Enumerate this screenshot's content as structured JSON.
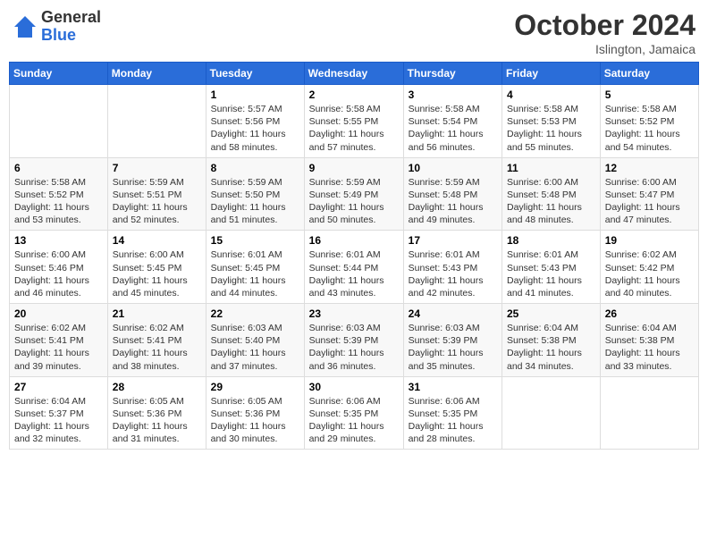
{
  "logo": {
    "general": "General",
    "blue": "Blue"
  },
  "title": "October 2024",
  "location": "Islington, Jamaica",
  "days_header": [
    "Sunday",
    "Monday",
    "Tuesday",
    "Wednesday",
    "Thursday",
    "Friday",
    "Saturday"
  ],
  "weeks": [
    [
      {
        "day": "",
        "sunrise": "",
        "sunset": "",
        "daylight": ""
      },
      {
        "day": "",
        "sunrise": "",
        "sunset": "",
        "daylight": ""
      },
      {
        "day": "1",
        "sunrise": "Sunrise: 5:57 AM",
        "sunset": "Sunset: 5:56 PM",
        "daylight": "Daylight: 11 hours and 58 minutes."
      },
      {
        "day": "2",
        "sunrise": "Sunrise: 5:58 AM",
        "sunset": "Sunset: 5:55 PM",
        "daylight": "Daylight: 11 hours and 57 minutes."
      },
      {
        "day": "3",
        "sunrise": "Sunrise: 5:58 AM",
        "sunset": "Sunset: 5:54 PM",
        "daylight": "Daylight: 11 hours and 56 minutes."
      },
      {
        "day": "4",
        "sunrise": "Sunrise: 5:58 AM",
        "sunset": "Sunset: 5:53 PM",
        "daylight": "Daylight: 11 hours and 55 minutes."
      },
      {
        "day": "5",
        "sunrise": "Sunrise: 5:58 AM",
        "sunset": "Sunset: 5:52 PM",
        "daylight": "Daylight: 11 hours and 54 minutes."
      }
    ],
    [
      {
        "day": "6",
        "sunrise": "Sunrise: 5:58 AM",
        "sunset": "Sunset: 5:52 PM",
        "daylight": "Daylight: 11 hours and 53 minutes."
      },
      {
        "day": "7",
        "sunrise": "Sunrise: 5:59 AM",
        "sunset": "Sunset: 5:51 PM",
        "daylight": "Daylight: 11 hours and 52 minutes."
      },
      {
        "day": "8",
        "sunrise": "Sunrise: 5:59 AM",
        "sunset": "Sunset: 5:50 PM",
        "daylight": "Daylight: 11 hours and 51 minutes."
      },
      {
        "day": "9",
        "sunrise": "Sunrise: 5:59 AM",
        "sunset": "Sunset: 5:49 PM",
        "daylight": "Daylight: 11 hours and 50 minutes."
      },
      {
        "day": "10",
        "sunrise": "Sunrise: 5:59 AM",
        "sunset": "Sunset: 5:48 PM",
        "daylight": "Daylight: 11 hours and 49 minutes."
      },
      {
        "day": "11",
        "sunrise": "Sunrise: 6:00 AM",
        "sunset": "Sunset: 5:48 PM",
        "daylight": "Daylight: 11 hours and 48 minutes."
      },
      {
        "day": "12",
        "sunrise": "Sunrise: 6:00 AM",
        "sunset": "Sunset: 5:47 PM",
        "daylight": "Daylight: 11 hours and 47 minutes."
      }
    ],
    [
      {
        "day": "13",
        "sunrise": "Sunrise: 6:00 AM",
        "sunset": "Sunset: 5:46 PM",
        "daylight": "Daylight: 11 hours and 46 minutes."
      },
      {
        "day": "14",
        "sunrise": "Sunrise: 6:00 AM",
        "sunset": "Sunset: 5:45 PM",
        "daylight": "Daylight: 11 hours and 45 minutes."
      },
      {
        "day": "15",
        "sunrise": "Sunrise: 6:01 AM",
        "sunset": "Sunset: 5:45 PM",
        "daylight": "Daylight: 11 hours and 44 minutes."
      },
      {
        "day": "16",
        "sunrise": "Sunrise: 6:01 AM",
        "sunset": "Sunset: 5:44 PM",
        "daylight": "Daylight: 11 hours and 43 minutes."
      },
      {
        "day": "17",
        "sunrise": "Sunrise: 6:01 AM",
        "sunset": "Sunset: 5:43 PM",
        "daylight": "Daylight: 11 hours and 42 minutes."
      },
      {
        "day": "18",
        "sunrise": "Sunrise: 6:01 AM",
        "sunset": "Sunset: 5:43 PM",
        "daylight": "Daylight: 11 hours and 41 minutes."
      },
      {
        "day": "19",
        "sunrise": "Sunrise: 6:02 AM",
        "sunset": "Sunset: 5:42 PM",
        "daylight": "Daylight: 11 hours and 40 minutes."
      }
    ],
    [
      {
        "day": "20",
        "sunrise": "Sunrise: 6:02 AM",
        "sunset": "Sunset: 5:41 PM",
        "daylight": "Daylight: 11 hours and 39 minutes."
      },
      {
        "day": "21",
        "sunrise": "Sunrise: 6:02 AM",
        "sunset": "Sunset: 5:41 PM",
        "daylight": "Daylight: 11 hours and 38 minutes."
      },
      {
        "day": "22",
        "sunrise": "Sunrise: 6:03 AM",
        "sunset": "Sunset: 5:40 PM",
        "daylight": "Daylight: 11 hours and 37 minutes."
      },
      {
        "day": "23",
        "sunrise": "Sunrise: 6:03 AM",
        "sunset": "Sunset: 5:39 PM",
        "daylight": "Daylight: 11 hours and 36 minutes."
      },
      {
        "day": "24",
        "sunrise": "Sunrise: 6:03 AM",
        "sunset": "Sunset: 5:39 PM",
        "daylight": "Daylight: 11 hours and 35 minutes."
      },
      {
        "day": "25",
        "sunrise": "Sunrise: 6:04 AM",
        "sunset": "Sunset: 5:38 PM",
        "daylight": "Daylight: 11 hours and 34 minutes."
      },
      {
        "day": "26",
        "sunrise": "Sunrise: 6:04 AM",
        "sunset": "Sunset: 5:38 PM",
        "daylight": "Daylight: 11 hours and 33 minutes."
      }
    ],
    [
      {
        "day": "27",
        "sunrise": "Sunrise: 6:04 AM",
        "sunset": "Sunset: 5:37 PM",
        "daylight": "Daylight: 11 hours and 32 minutes."
      },
      {
        "day": "28",
        "sunrise": "Sunrise: 6:05 AM",
        "sunset": "Sunset: 5:36 PM",
        "daylight": "Daylight: 11 hours and 31 minutes."
      },
      {
        "day": "29",
        "sunrise": "Sunrise: 6:05 AM",
        "sunset": "Sunset: 5:36 PM",
        "daylight": "Daylight: 11 hours and 30 minutes."
      },
      {
        "day": "30",
        "sunrise": "Sunrise: 6:06 AM",
        "sunset": "Sunset: 5:35 PM",
        "daylight": "Daylight: 11 hours and 29 minutes."
      },
      {
        "day": "31",
        "sunrise": "Sunrise: 6:06 AM",
        "sunset": "Sunset: 5:35 PM",
        "daylight": "Daylight: 11 hours and 28 minutes."
      },
      {
        "day": "",
        "sunrise": "",
        "sunset": "",
        "daylight": ""
      },
      {
        "day": "",
        "sunrise": "",
        "sunset": "",
        "daylight": ""
      }
    ]
  ]
}
